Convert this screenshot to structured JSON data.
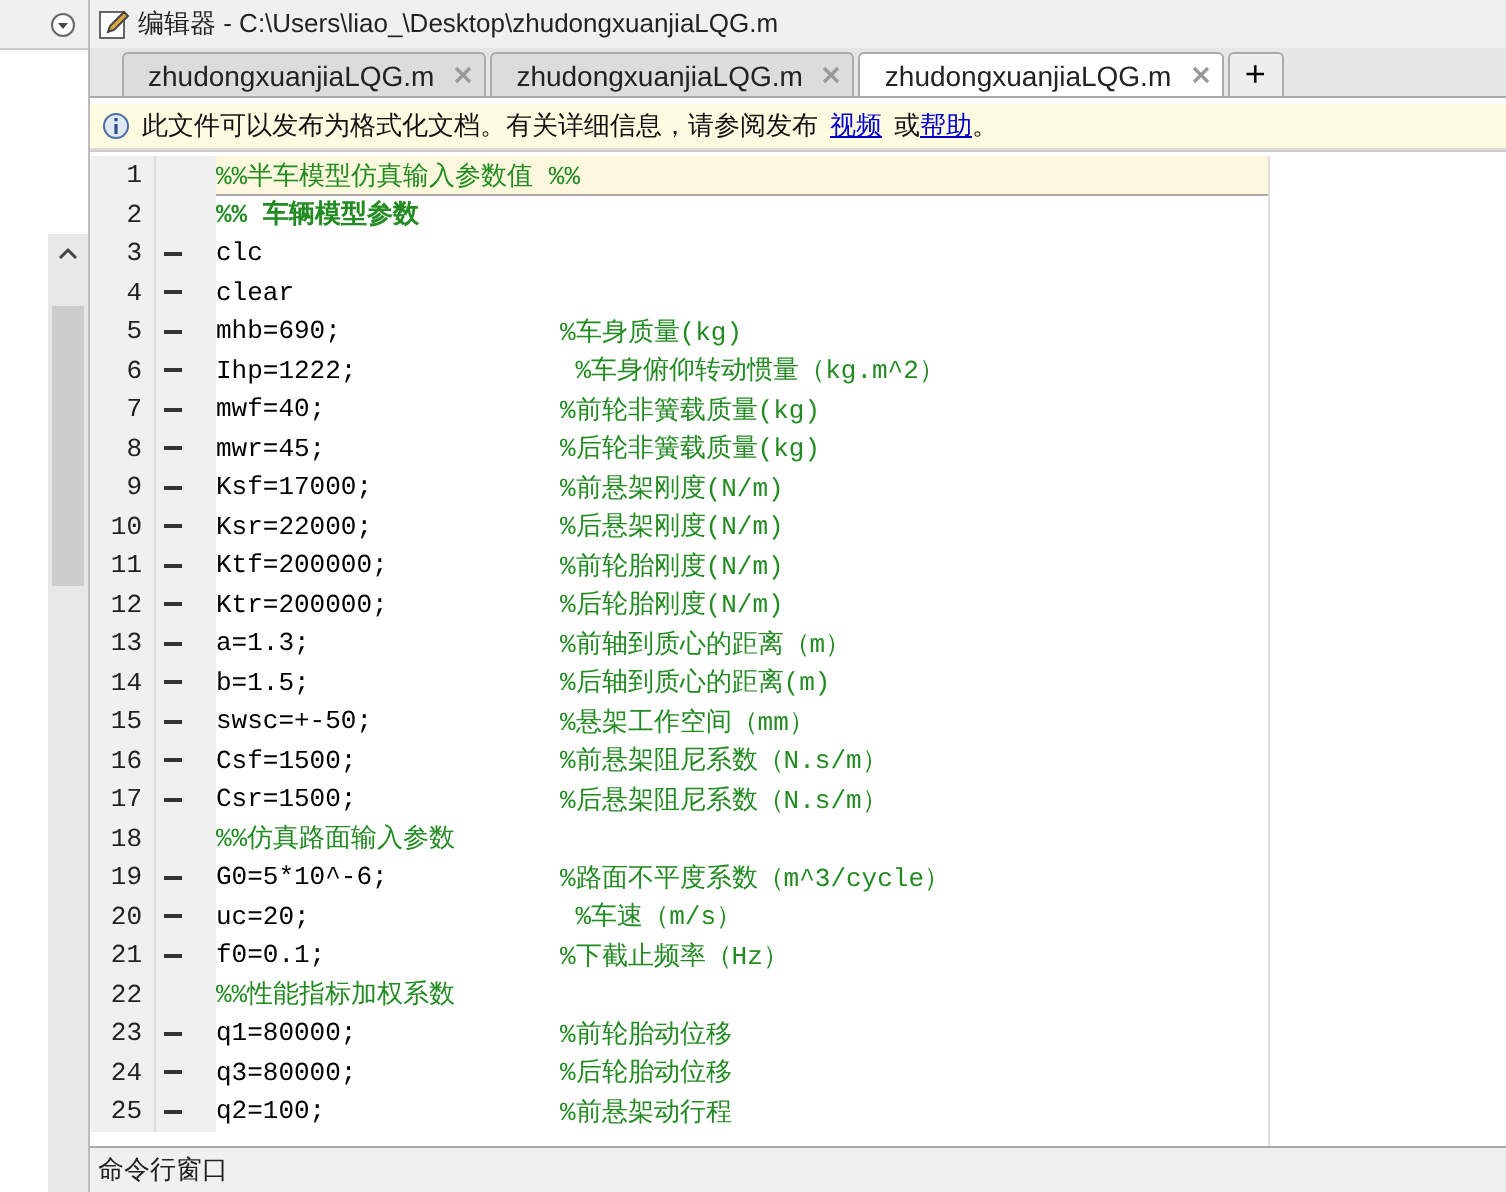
{
  "window": {
    "title": "编辑器 - C:\\Users\\liao_\\Desktop\\zhudongxuanjiaLQG.m"
  },
  "tabs": [
    {
      "label": "zhudongxuanjiaLQG.m",
      "selected": false
    },
    {
      "label": "zhudongxuanjiaLQG.m",
      "selected": false
    },
    {
      "label": "zhudongxuanjiaLQG.m",
      "selected": true
    }
  ],
  "add_tab": "+",
  "info_bar": {
    "text": "此文件可以发布为格式化文档。有关详细信息，请参阅发布",
    "link_1": "视频",
    "conjunction": "或",
    "link_2": "帮助",
    "end": "。"
  },
  "lines": [
    {
      "number": "1",
      "executable": false,
      "kind": "section",
      "highlighted": true,
      "code": "%%半车模型仿真输入参数值 %%"
    },
    {
      "number": "2",
      "executable": false,
      "kind": "section_title",
      "highlighted": false,
      "code": "%% 车辆模型参数"
    },
    {
      "number": "3",
      "executable": true,
      "kind": "code",
      "highlighted": false,
      "code": "clc"
    },
    {
      "number": "4",
      "executable": true,
      "kind": "code",
      "highlighted": false,
      "code": "clear"
    },
    {
      "number": "5",
      "executable": true,
      "kind": "code",
      "highlighted": false,
      "code": "mhb=690;",
      "comment": "%车身质量(kg)"
    },
    {
      "number": "6",
      "executable": true,
      "kind": "code",
      "highlighted": false,
      "code": "Ihp=1222;",
      "comment": " %车身俯仰转动惯量（kg.m^2）"
    },
    {
      "number": "7",
      "executable": true,
      "kind": "code",
      "highlighted": false,
      "code": "mwf=40;",
      "comment": "%前轮非簧载质量(kg)"
    },
    {
      "number": "8",
      "executable": true,
      "kind": "code",
      "highlighted": false,
      "code": "mwr=45;",
      "comment": "%后轮非簧载质量(kg)"
    },
    {
      "number": "9",
      "executable": true,
      "kind": "code",
      "highlighted": false,
      "code": "Ksf=17000;",
      "comment": "%前悬架刚度(N/m)"
    },
    {
      "number": "10",
      "executable": true,
      "kind": "code",
      "highlighted": false,
      "code": "Ksr=22000;",
      "comment": "%后悬架刚度(N/m)"
    },
    {
      "number": "11",
      "executable": true,
      "kind": "code",
      "highlighted": false,
      "code": "Ktf=200000;",
      "comment": "%前轮胎刚度(N/m)"
    },
    {
      "number": "12",
      "executable": true,
      "kind": "code",
      "highlighted": false,
      "code": "Ktr=200000;",
      "comment": "%后轮胎刚度(N/m)"
    },
    {
      "number": "13",
      "executable": true,
      "kind": "code",
      "highlighted": false,
      "code": "a=1.3;",
      "comment": "%前轴到质心的距离（m）"
    },
    {
      "number": "14",
      "executable": true,
      "kind": "code",
      "highlighted": false,
      "code": "b=1.5;",
      "comment": "%后轴到质心的距离(m)"
    },
    {
      "number": "15",
      "executable": true,
      "kind": "code",
      "highlighted": false,
      "code": "swsc=+-50;",
      "comment": "%悬架工作空间（mm）"
    },
    {
      "number": "16",
      "executable": true,
      "kind": "code",
      "highlighted": false,
      "code": "Csf=1500;",
      "comment": "%前悬架阻尼系数（N.s/m）"
    },
    {
      "number": "17",
      "executable": true,
      "kind": "code",
      "highlighted": false,
      "code": "Csr=1500;",
      "comment": "%后悬架阻尼系数（N.s/m）"
    },
    {
      "number": "18",
      "executable": false,
      "kind": "section",
      "highlighted": false,
      "code": "%%仿真路面输入参数"
    },
    {
      "number": "19",
      "executable": true,
      "kind": "code",
      "highlighted": false,
      "code": "G0=5*10^-6;",
      "comment": "%路面不平度系数（m^3/cycle）"
    },
    {
      "number": "20",
      "executable": true,
      "kind": "code",
      "highlighted": false,
      "code": "uc=20;",
      "comment": " %车速（m/s）"
    },
    {
      "number": "21",
      "executable": true,
      "kind": "code",
      "highlighted": false,
      "code": "f0=0.1;",
      "comment": "%下截止频率（Hz）"
    },
    {
      "number": "22",
      "executable": false,
      "kind": "section",
      "highlighted": false,
      "code": "%%性能指标加权系数"
    },
    {
      "number": "23",
      "executable": true,
      "kind": "code",
      "highlighted": false,
      "code": "q1=80000;",
      "comment": "%前轮胎动位移"
    },
    {
      "number": "24",
      "executable": true,
      "kind": "code",
      "highlighted": false,
      "code": "q3=80000;",
      "comment": "%后轮胎动位移"
    },
    {
      "number": "25",
      "executable": true,
      "kind": "code",
      "highlighted": false,
      "code": "q2=100;",
      "comment": "%前悬架动行程"
    }
  ],
  "command_window": {
    "title": "命令行窗口"
  }
}
